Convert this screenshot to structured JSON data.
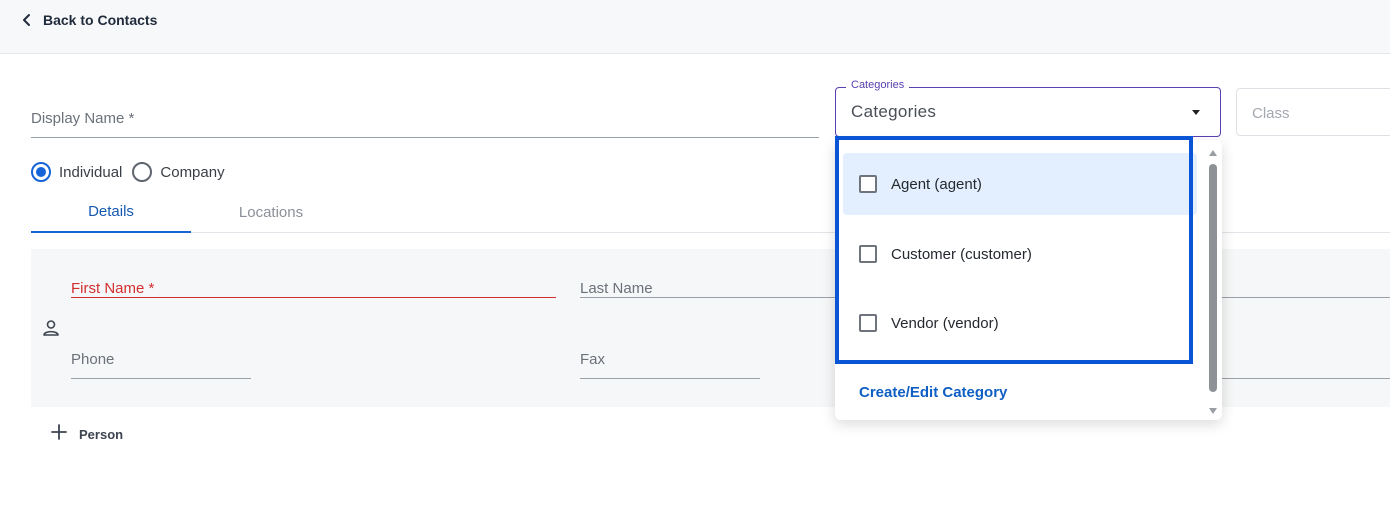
{
  "header": {
    "back_label": "Back to Contacts",
    "back_icon": "chevron-left-icon"
  },
  "form": {
    "display_name_label": "Display Name *",
    "contact_type": {
      "options": [
        "Individual",
        "Company"
      ],
      "selected": "Individual"
    },
    "tabs": [
      "Details",
      "Locations"
    ],
    "active_tab": "Details",
    "person": {
      "icon": "person-icon",
      "first_name_label": "First Name *",
      "last_name_label": "Last Name",
      "phone_label": "Phone",
      "fax_label": "Fax"
    },
    "add_person_label": "Person",
    "add_person_icon": "plus-icon"
  },
  "categories": {
    "float_label": "Categories",
    "value": "Categories",
    "dropdown": {
      "options": [
        {
          "label": "Agent (agent)",
          "checked": false,
          "hovered": true
        },
        {
          "label": "Customer (customer)",
          "checked": false,
          "hovered": false
        },
        {
          "label": "Vendor (vendor)",
          "checked": false,
          "hovered": false
        }
      ],
      "create_label": "Create/Edit Category"
    }
  },
  "class_field": {
    "placeholder": "Class"
  },
  "colors": {
    "accent": "#1565d8",
    "error": "#d32f2f",
    "highlight_border": "#0a55d6",
    "categories_border": "#5a3fb3",
    "hover_bg": "#e3efff"
  }
}
